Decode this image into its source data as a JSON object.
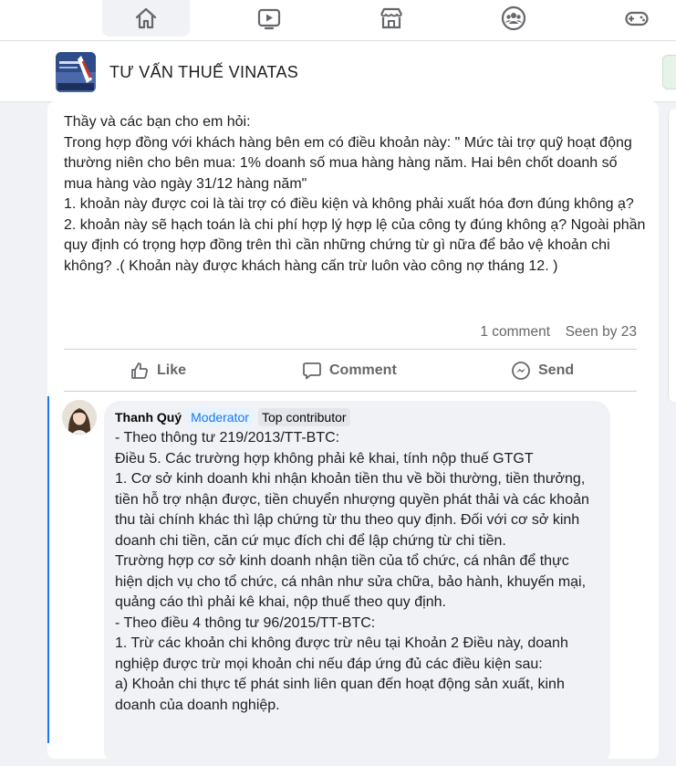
{
  "nav": {
    "tabs": [
      {
        "icon": "home-icon",
        "active": true
      },
      {
        "icon": "video-icon",
        "active": false
      },
      {
        "icon": "marketplace-icon",
        "active": false
      },
      {
        "icon": "groups-icon",
        "active": false
      },
      {
        "icon": "gaming-icon",
        "active": false
      }
    ]
  },
  "group": {
    "name": "TƯ VẤN THUẾ VINATAS"
  },
  "post": {
    "paragraphs": [
      "Thầy và các bạn cho em hỏi:",
      "Trong hợp đồng với khách hàng bên em có điều khoản này: \" Mức tài trợ quỹ hoạt động thường niên cho bên mua: 1% doanh số mua hàng hàng năm. Hai bên chốt doanh số mua hàng vào ngày 31/12 hàng năm\"",
      "1. khoản này được coi là tài trợ có điều kiện và không phải xuất hóa đơn đúng không ạ?",
      "2. khoản này sẽ hạch toán là chi phí hợp lý hợp lệ của công ty đúng không ạ? Ngoài phần quy định có trọng hợp đồng trên thì cần những chứng từ gì nữa để bảo vệ khoản chi không? .( Khoản này được khách hàng cấn trừ luôn vào công nợ tháng 12. )"
    ],
    "comments_count": "1 comment",
    "seen_by": "Seen by 23",
    "actions": {
      "like": "Like",
      "comment": "Comment",
      "send": "Send"
    }
  },
  "comment": {
    "author": "Thanh Quý",
    "badge_moderator": "Moderator",
    "badge_top": "Top contributor",
    "paragraphs": [
      "- Theo thông tư 219/2013/TT-BTC:",
      "Điều 5. Các trường hợp không phải kê khai, tính nộp thuế GTGT",
      "1. Cơ sở kinh doanh khi nhận khoản tiền thu về bồi thường, tiền thưởng, tiền hỗ trợ nhận được, tiền chuyển nhượng quyền phát thải và các khoản thu tài chính khác thì lập chứng từ thu theo quy định. Đối với cơ sở kinh doanh chi tiền, căn cứ mục đích chi để lập chứng từ chi tiền.",
      "Trường hợp cơ sở kinh doanh nhận tiền của tổ chức, cá nhân để thực hiện dịch vụ cho tổ chức, cá nhân như sửa chữa, bảo hành, khuyến mại, quảng cáo thì phải kê khai, nộp thuế theo quy định.",
      "- Theo điều 4 thông tư 96/2015/TT-BTC:",
      "1. Trừ các khoản chi không được trừ nêu tại Khoản 2 Điều này, doanh nghiệp được trừ mọi khoản chi nếu đáp ứng đủ các điều kiện sau:",
      "a) Khoản chi thực tế phát sinh liên quan đến hoạt động sản xuất, kinh doanh của doanh nghiệp."
    ]
  },
  "colors": {
    "accent": "#1877f2",
    "icon_gray": "#65676b"
  }
}
